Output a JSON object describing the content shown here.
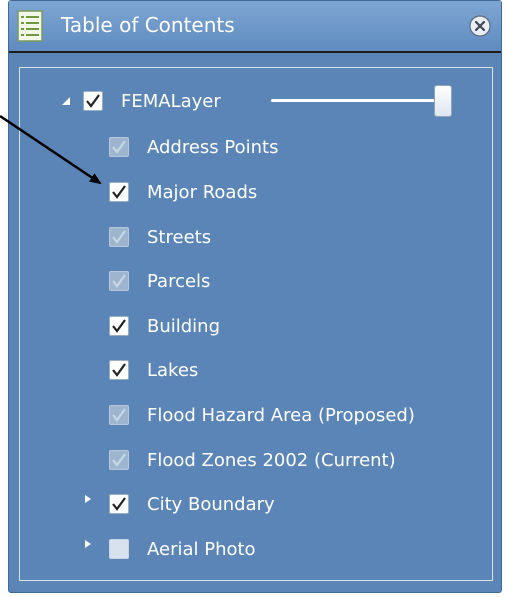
{
  "header": {
    "title": "Table of Contents",
    "icon": "table-of-contents-icon",
    "close_icon": "close-icon"
  },
  "layers": [
    {
      "label": "FEMALayer",
      "checked": true,
      "state": "on",
      "expander": "expanded"
    },
    {
      "label": "Address Points",
      "checked": true,
      "state": "dim"
    },
    {
      "label": "Major Roads",
      "checked": true,
      "state": "on"
    },
    {
      "label": "Streets",
      "checked": true,
      "state": "dim"
    },
    {
      "label": "Parcels",
      "checked": true,
      "state": "dim"
    },
    {
      "label": "Building",
      "checked": true,
      "state": "on"
    },
    {
      "label": "Lakes",
      "checked": true,
      "state": "on"
    },
    {
      "label": "Flood Hazard Area (Proposed)",
      "checked": true,
      "state": "dim"
    },
    {
      "label": "Flood Zones 2002 (Current)",
      "checked": true,
      "state": "dim"
    },
    {
      "label": "City Boundary",
      "checked": true,
      "state": "on",
      "expander": "collapsed"
    },
    {
      "label": "Aerial Photo",
      "checked": false,
      "state": "empty",
      "expander": "collapsed"
    }
  ],
  "opacity_slider": {
    "value": 1.0
  },
  "colors": {
    "panel": "#5a85b6",
    "header": "#6f9acb",
    "text": "#ffffff"
  }
}
